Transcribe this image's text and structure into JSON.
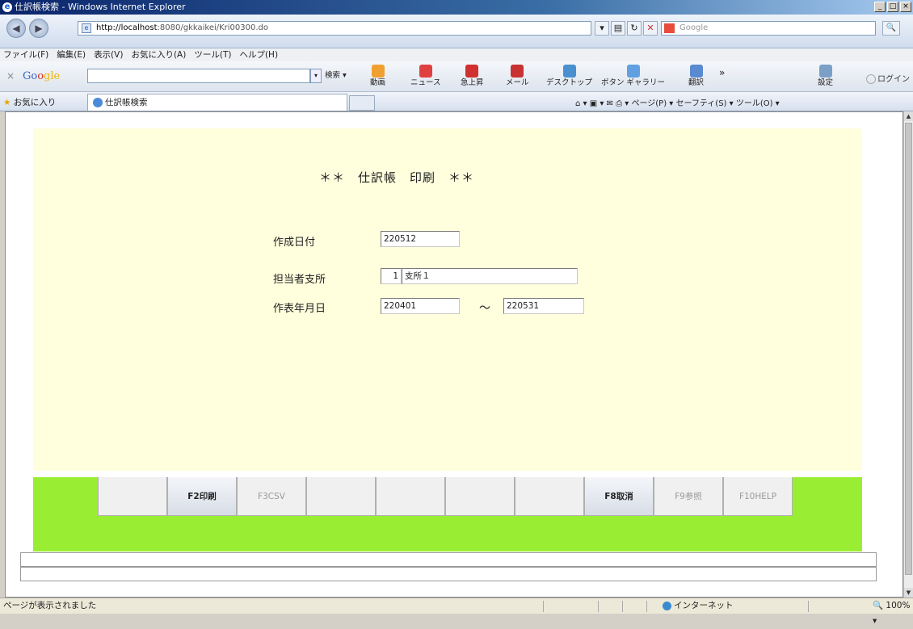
{
  "window": {
    "title": "仕訳帳検索 - Windows Internet Explorer",
    "minimize": "_",
    "maximize": "□",
    "close": "×"
  },
  "addressbar": {
    "url_host": "http://localhost",
    "url_rest": ":8080/gkkaikei/Kri00300.do",
    "search_engine": "Google"
  },
  "menubar": {
    "items": [
      "ファイル(F)",
      "編集(E)",
      "表示(V)",
      "お気に入り(A)",
      "ツール(T)",
      "ヘルプ(H)"
    ]
  },
  "google_toolbar": {
    "close": "×",
    "logo": [
      "Go",
      "o",
      "gle"
    ],
    "search_label": "検索",
    "tools": [
      "動画",
      "ニュース",
      "急上昇",
      "メール",
      "デスクトップ",
      "ボタン ギャラリー",
      "翻訳",
      "設定"
    ],
    "more": "»",
    "login": "ログイン"
  },
  "favorites_bar": {
    "favorites_label": "お気に入り",
    "tab_title": "仕訳帳検索",
    "commands": "ページ(P) ▾  セーフティ(S) ▾  ツール(O) ▾"
  },
  "form": {
    "heading": "＊＊　仕訳帳　印刷　＊＊",
    "created_date_label": "作成日付",
    "created_date_value": "220512",
    "branch_label": "担当者支所",
    "branch_code": "1",
    "branch_name": "支所１",
    "period_label": "作表年月日",
    "period_from": "220401",
    "period_sep": "～",
    "period_to": "220531"
  },
  "function_keys": [
    {
      "label": "",
      "enabled": false
    },
    {
      "label": "F2印刷",
      "enabled": true
    },
    {
      "label": "F3CSV",
      "enabled": false
    },
    {
      "label": "",
      "enabled": false
    },
    {
      "label": "",
      "enabled": false
    },
    {
      "label": "",
      "enabled": false
    },
    {
      "label": "",
      "enabled": false
    },
    {
      "label": "F8取消",
      "enabled": true
    },
    {
      "label": "F9参照",
      "enabled": false
    },
    {
      "label": "F10HELP",
      "enabled": false
    }
  ],
  "statusbar": {
    "message": "ページが表示されました",
    "zone": "インターネット",
    "zoom": "100%"
  },
  "colors": {
    "panel_bg": "#ffffdd",
    "fkey_band": "#99ee33"
  }
}
